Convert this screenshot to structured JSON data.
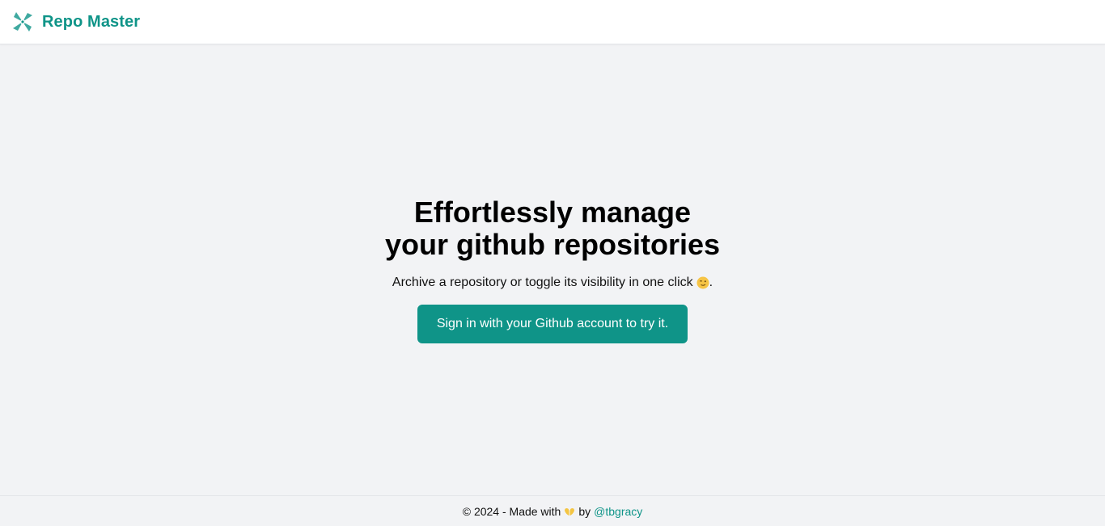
{
  "header": {
    "app_name": "Repo Master",
    "logo_icon": "shuriken-icon"
  },
  "hero": {
    "title_line1": "Effortlessly manage",
    "title_line2": "your github repositories",
    "subtitle_text": "Archive a repository or toggle its visibility in one click",
    "subtitle_icon": "winking-face-icon",
    "subtitle_end": ".",
    "signin_label": "Sign in with your Github account to try it."
  },
  "footer": {
    "prefix": "© 2024 - Made with",
    "heart_icon": "yellow-heart-hands-icon",
    "by": "by",
    "author_link": "@tbgracy"
  },
  "colors": {
    "accent": "#0f9488",
    "background": "#f2f3f5",
    "header_bg": "#ffffff"
  }
}
